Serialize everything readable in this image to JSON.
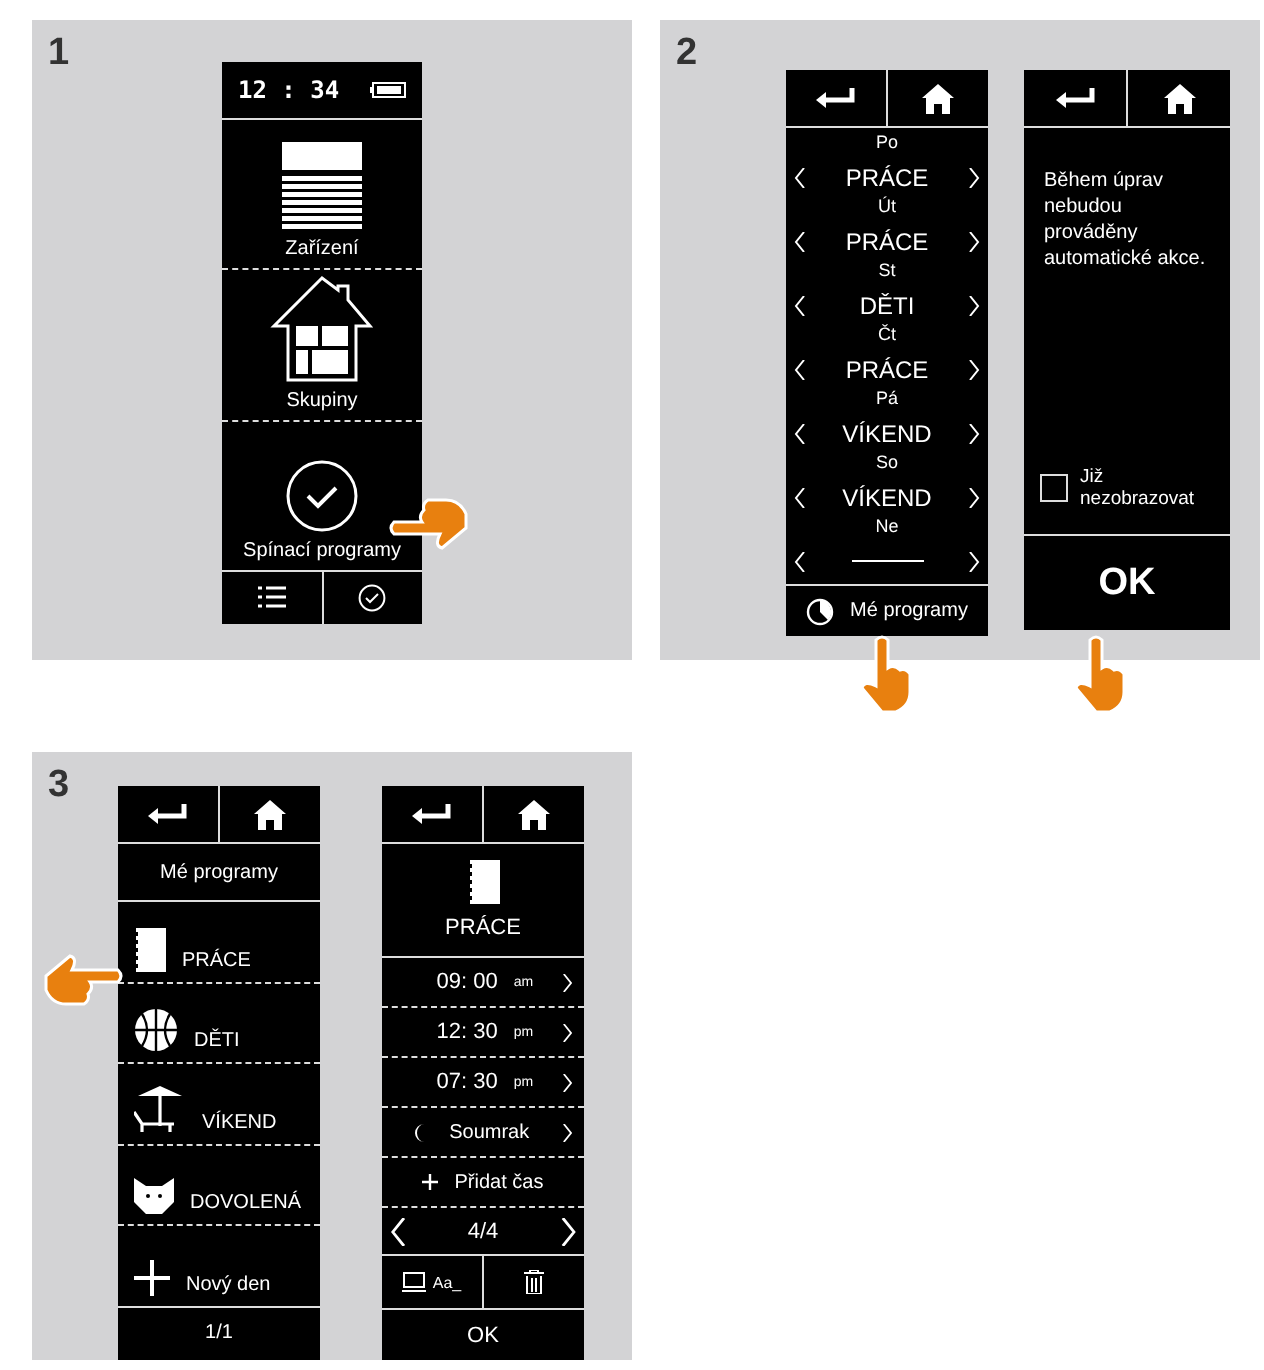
{
  "steps": [
    {
      "number": "1",
      "screens": [
        {
          "kind": "home",
          "clock": "12 : 34",
          "items": [
            "Zařízení",
            "Skupiny",
            "Spínací programy"
          ]
        }
      ]
    },
    {
      "number": "2",
      "screens": [
        {
          "kind": "week",
          "days": [
            {
              "day": "Po",
              "program": "PRÁCE"
            },
            {
              "day": "Út",
              "program": "PRÁCE"
            },
            {
              "day": "St",
              "program": "DĚTI"
            },
            {
              "day": "Čt",
              "program": "PRÁCE"
            },
            {
              "day": "Pá",
              "program": "VÍKEND"
            },
            {
              "day": "So",
              "program": "VÍKEND"
            },
            {
              "day": "Ne"
            }
          ],
          "footer": "Mé programy"
        },
        {
          "kind": "notice",
          "message": "Během úprav nebudou prováděny automatické akce.",
          "checkbox": {
            "label": "Již nezobrazovat",
            "checked": false
          },
          "button": "OK"
        }
      ]
    },
    {
      "number": "3",
      "screens": [
        {
          "kind": "programs",
          "title": "Mé programy",
          "items": [
            "PRÁCE",
            "DĚTI",
            "VÍKEND",
            "DOVOLENÁ",
            "Nový den"
          ],
          "footer": "1/1"
        },
        {
          "kind": "program",
          "title": "PRÁCE",
          "rows": [
            {
              "kind": "time",
              "time": "09: 00",
              "period": "am"
            },
            {
              "kind": "time",
              "time": "12: 30",
              "period": "pm"
            },
            {
              "kind": "time",
              "time": "07: 30",
              "period": "pm"
            },
            {
              "kind": "dusk",
              "label": "Soumrak"
            },
            {
              "kind": "add",
              "label": "Přidat čas"
            }
          ],
          "pager": "4/4",
          "rename": "Aa_",
          "button": "OK"
        }
      ]
    }
  ]
}
